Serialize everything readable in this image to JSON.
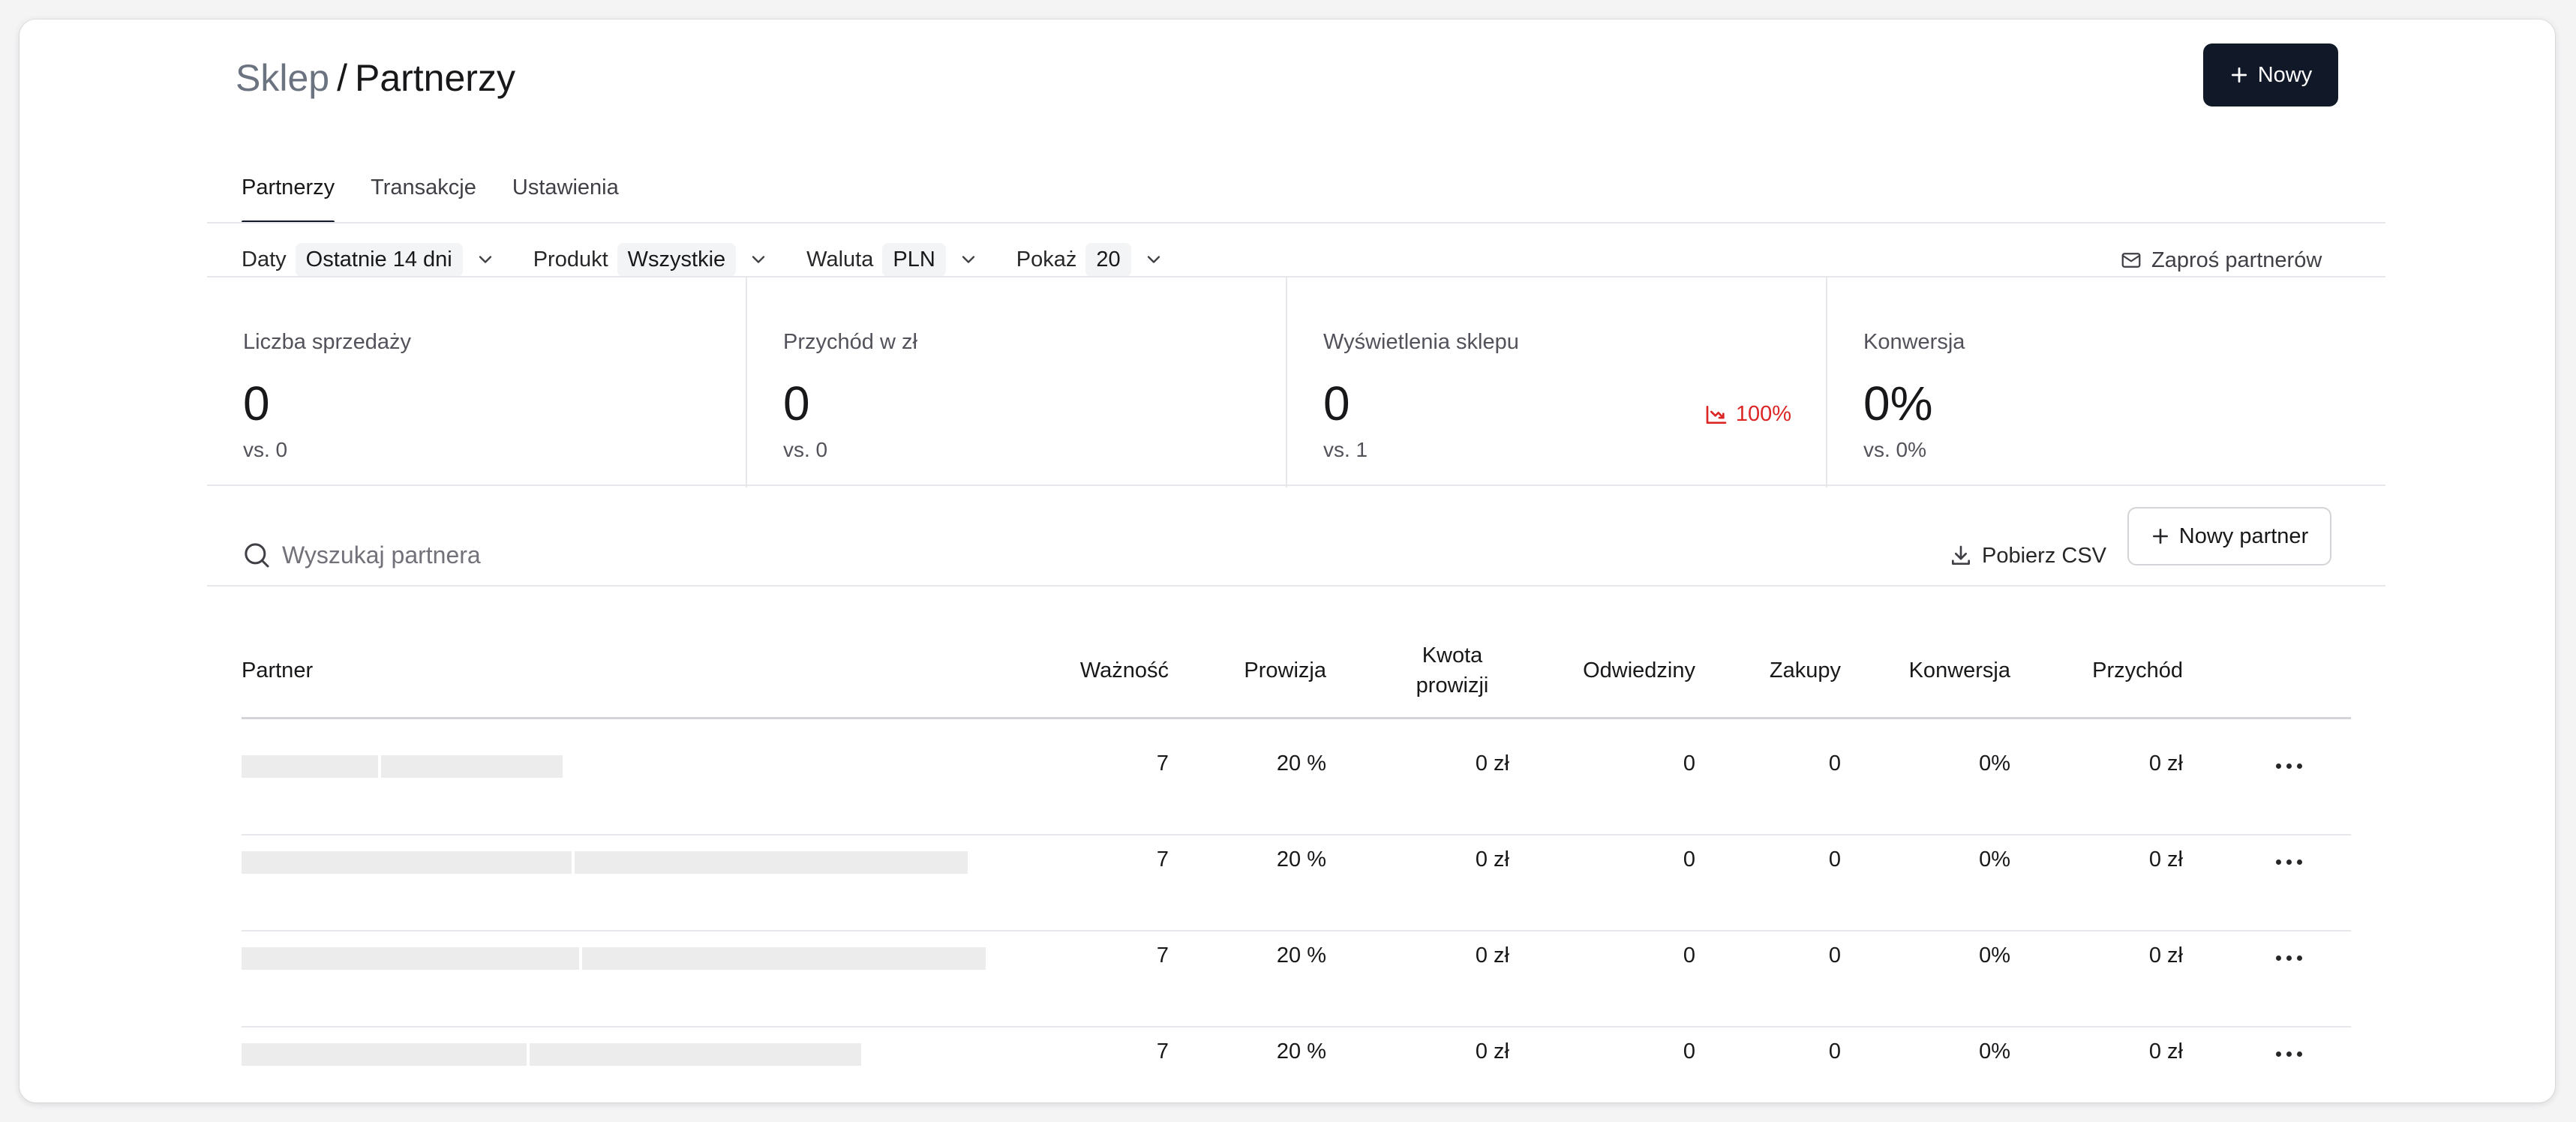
{
  "header": {
    "breadcrumb_parent": "Sklep",
    "separator": "/",
    "page_title": "Partnerzy",
    "new_button_label": "Nowy"
  },
  "tabs": [
    {
      "label": "Partnerzy",
      "active": true
    },
    {
      "label": "Transakcje",
      "active": false
    },
    {
      "label": "Ustawienia",
      "active": false
    }
  ],
  "filters": {
    "dates": {
      "label": "Daty",
      "value": "Ostatnie 14 dni"
    },
    "product": {
      "label": "Produkt",
      "value": "Wszystkie"
    },
    "currency": {
      "label": "Waluta",
      "value": "PLN"
    },
    "show": {
      "label": "Pokaż",
      "value": "20"
    },
    "invite_label": "Zaproś partnerów"
  },
  "stats": [
    {
      "label": "Liczba sprzedaży",
      "value": "0",
      "vs": "vs. 0"
    },
    {
      "label": "Przychód w zł",
      "value": "0",
      "vs": "vs. 0"
    },
    {
      "label": "Wyświetlenia sklepu",
      "value": "0",
      "vs": "vs. 1",
      "delta": "100%",
      "delta_color": "#dc2626"
    },
    {
      "label": "Konwersja",
      "value": "0%",
      "vs": "vs. 0%"
    }
  ],
  "toolbar": {
    "search_placeholder": "Wyszukaj partnera",
    "csv_label": "Pobierz CSV",
    "new_partner_label": "Nowy partner"
  },
  "table": {
    "headers": {
      "partner": "Partner",
      "validity": "Ważność",
      "commission": "Prowizja",
      "commission_amount_1": "Kwota",
      "commission_amount_2": "prowizji",
      "visits": "Odwiedziny",
      "purchases": "Zakupy",
      "conversion": "Konwersja",
      "revenue": "Przychód"
    },
    "rows": [
      {
        "validity": "7",
        "commission": "20 %",
        "commission_amount": "0 zł",
        "visits": "0",
        "purchases": "0",
        "conversion": "0%",
        "revenue": "0 zł"
      },
      {
        "validity": "7",
        "commission": "20 %",
        "commission_amount": "0 zł",
        "visits": "0",
        "purchases": "0",
        "conversion": "0%",
        "revenue": "0 zł"
      },
      {
        "validity": "7",
        "commission": "20 %",
        "commission_amount": "0 zł",
        "visits": "0",
        "purchases": "0",
        "conversion": "0%",
        "revenue": "0 zł"
      },
      {
        "validity": "7",
        "commission": "20 %",
        "commission_amount": "0 zł",
        "visits": "0",
        "purchases": "0",
        "conversion": "0%",
        "revenue": "0 zł"
      }
    ]
  },
  "icons": {
    "plus": "plus-icon",
    "chevron": "chevron-down-icon",
    "mail": "mail-icon",
    "trend_down": "trending-down-icon",
    "search": "search-icon",
    "download": "download-icon",
    "more": "more-horizontal-icon"
  },
  "colors": {
    "primary_button": "#111827",
    "negative_delta": "#dc2626",
    "skeleton": "#ececec"
  }
}
